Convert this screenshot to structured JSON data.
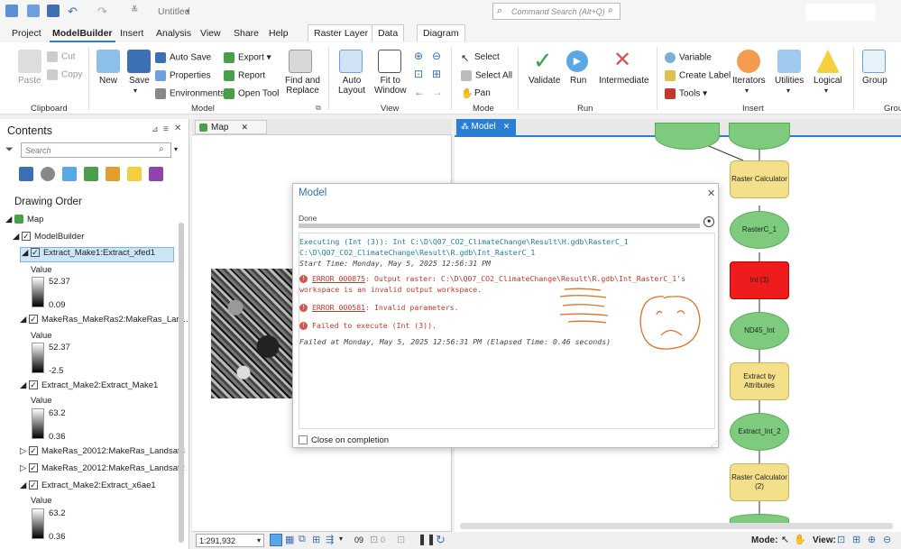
{
  "titlebar": {
    "doc_title": "Untitled",
    "command_search_placeholder": "Command Search (Alt+Q)"
  },
  "menu": {
    "items": [
      "Project",
      "ModelBuilder",
      "Insert",
      "Analysis",
      "View",
      "Share",
      "Help"
    ],
    "ctx_tabs": [
      "Raster Layer",
      "Data",
      "Diagram"
    ]
  },
  "ribbon": {
    "clipboard": {
      "paste": "Paste",
      "cut": "Cut",
      "copy": "Copy",
      "group": "Clipboard"
    },
    "model": {
      "new": "New",
      "save": "Save",
      "auto_save": "Auto Save",
      "properties": "Properties",
      "environments": "Environments",
      "export": "Export",
      "report": "Report",
      "open_tool": "Open Tool",
      "find_replace_1": "Find and",
      "find_replace_2": "Replace",
      "group": "Model"
    },
    "view": {
      "auto_layout_1": "Auto",
      "auto_layout_2": "Layout",
      "fit_1": "Fit to",
      "fit_2": "Window",
      "group": "View"
    },
    "mode": {
      "select": "Select",
      "select_all": "Select All",
      "pan": "Pan",
      "group": "Mode"
    },
    "run": {
      "validate": "Validate",
      "run": "Run",
      "intermediate": "Intermediate",
      "group": "Run"
    },
    "insert": {
      "variable": "Variable",
      "create_label": "Create Label",
      "tools": "Tools",
      "iterators": "Iterators",
      "utilities": "Utilities",
      "logical": "Logical",
      "group": "Insert"
    },
    "group": {
      "group": "Group",
      "group_label": "Grou"
    }
  },
  "contents": {
    "title": "Contents",
    "search_placeholder": "Search",
    "drawing_order": "Drawing Order",
    "map": "Map",
    "modelbuilder": "ModelBuilder",
    "layers": [
      {
        "name": "Extract_Make1:Extract_xfed1",
        "value": "Value",
        "max": "52.37",
        "min": "0.09"
      },
      {
        "name": "MakeRas_MakeRas2:MakeRas_Lan...",
        "value": "Value",
        "max": "52.37",
        "min": "-2.5"
      },
      {
        "name": "Extract_Make2:Extract_Make1",
        "value": "Value",
        "max": "63.2",
        "min": "0.36"
      },
      {
        "name": "MakeRas_20012:MakeRas_Landsat3"
      },
      {
        "name": "MakeRas_20012:MakeRas_Landsat2"
      },
      {
        "name": "Extract_Make2:Extract_x6ae1",
        "value": "Value",
        "max": "63.2",
        "min": "0.36"
      }
    ]
  },
  "map_pane": {
    "tab": "Map",
    "scale": "1:291,932",
    "count": "09",
    "zero": "0"
  },
  "model_pane": {
    "tab": "Model",
    "mode_label": "Mode:",
    "view_label": "View:"
  },
  "nodes": {
    "raster_calc": "Raster Calculator",
    "rasterc1": "RasterC_1",
    "int3": "Int (3)",
    "nd45": "ND45_Int",
    "extract_attr": "Extract by Attributes",
    "extract_int2": "Extract_Int_2",
    "raster_calc2": "Raster Calculator (2)"
  },
  "dialog": {
    "title": "Model",
    "status": "Done",
    "line1": "Executing (Int (3)): Int C:\\D\\Q07_CO2_ClimateChange\\Result\\H.gdb\\RasterC_1",
    "line2": "C:\\D\\Q07_CO2_ClimateChange\\Result\\R.gdb\\Int_RasterC_1",
    "start": "Start Time: Monday, May 5, 2025 12:56:31 PM",
    "err1_code": "ERROR 000875",
    "err1_text": ": Output raster: C:\\D\\Q07_CO2_ClimateChange\\Result\\R.gdb\\Int_RasterC_1's",
    "err1_text2": "workspace is an invalid output workspace.",
    "err2_code": "ERROR 000581",
    "err2_text": ": Invalid parameters.",
    "err3_text": "Failed to execute (Int (3)).",
    "failed": "Failed at Monday, May 5, 2025 12:56:31 PM (Elapsed Time: 0.46 seconds)",
    "close_on_completion": "Close on completion",
    "progress": 1.0
  }
}
